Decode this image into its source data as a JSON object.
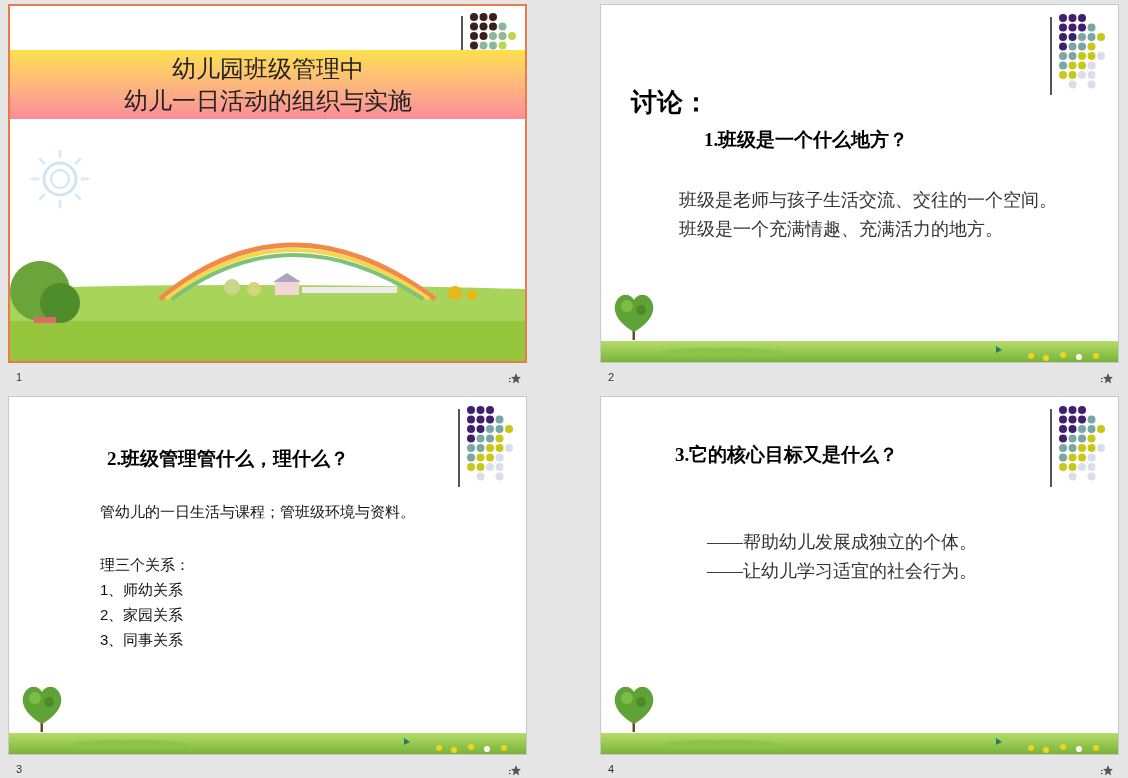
{
  "slides": [
    {
      "number": "1",
      "selected": true,
      "kind": "title",
      "title_lines": [
        "幼儿园班级管理中",
        "幼儿一日活动的组织与实施"
      ]
    },
    {
      "number": "2",
      "selected": false,
      "kind": "discussion",
      "heading": "讨论：",
      "subheading": "1.班级是一个什么地方？",
      "lines": [
        "班级是老师与孩子生活交流、交往的一个空间。",
        "班级是一个充满情趣、充满活力的地方。"
      ]
    },
    {
      "number": "3",
      "selected": false,
      "kind": "list",
      "heading": "2.班级管理管什么，理什么？",
      "intro": "管幼儿的一日生活与课程；管班级环境与资料。",
      "lines": [
        "理三个关系：",
        "1、师幼关系",
        "2、家园关系",
        "3、同事关系"
      ]
    },
    {
      "number": "4",
      "selected": false,
      "kind": "goals",
      "heading": "3.它的核心目标又是什么？",
      "lines": [
        "——帮助幼儿发展成独立的个体。",
        "——让幼儿学习适宜的社会行为。"
      ]
    }
  ]
}
